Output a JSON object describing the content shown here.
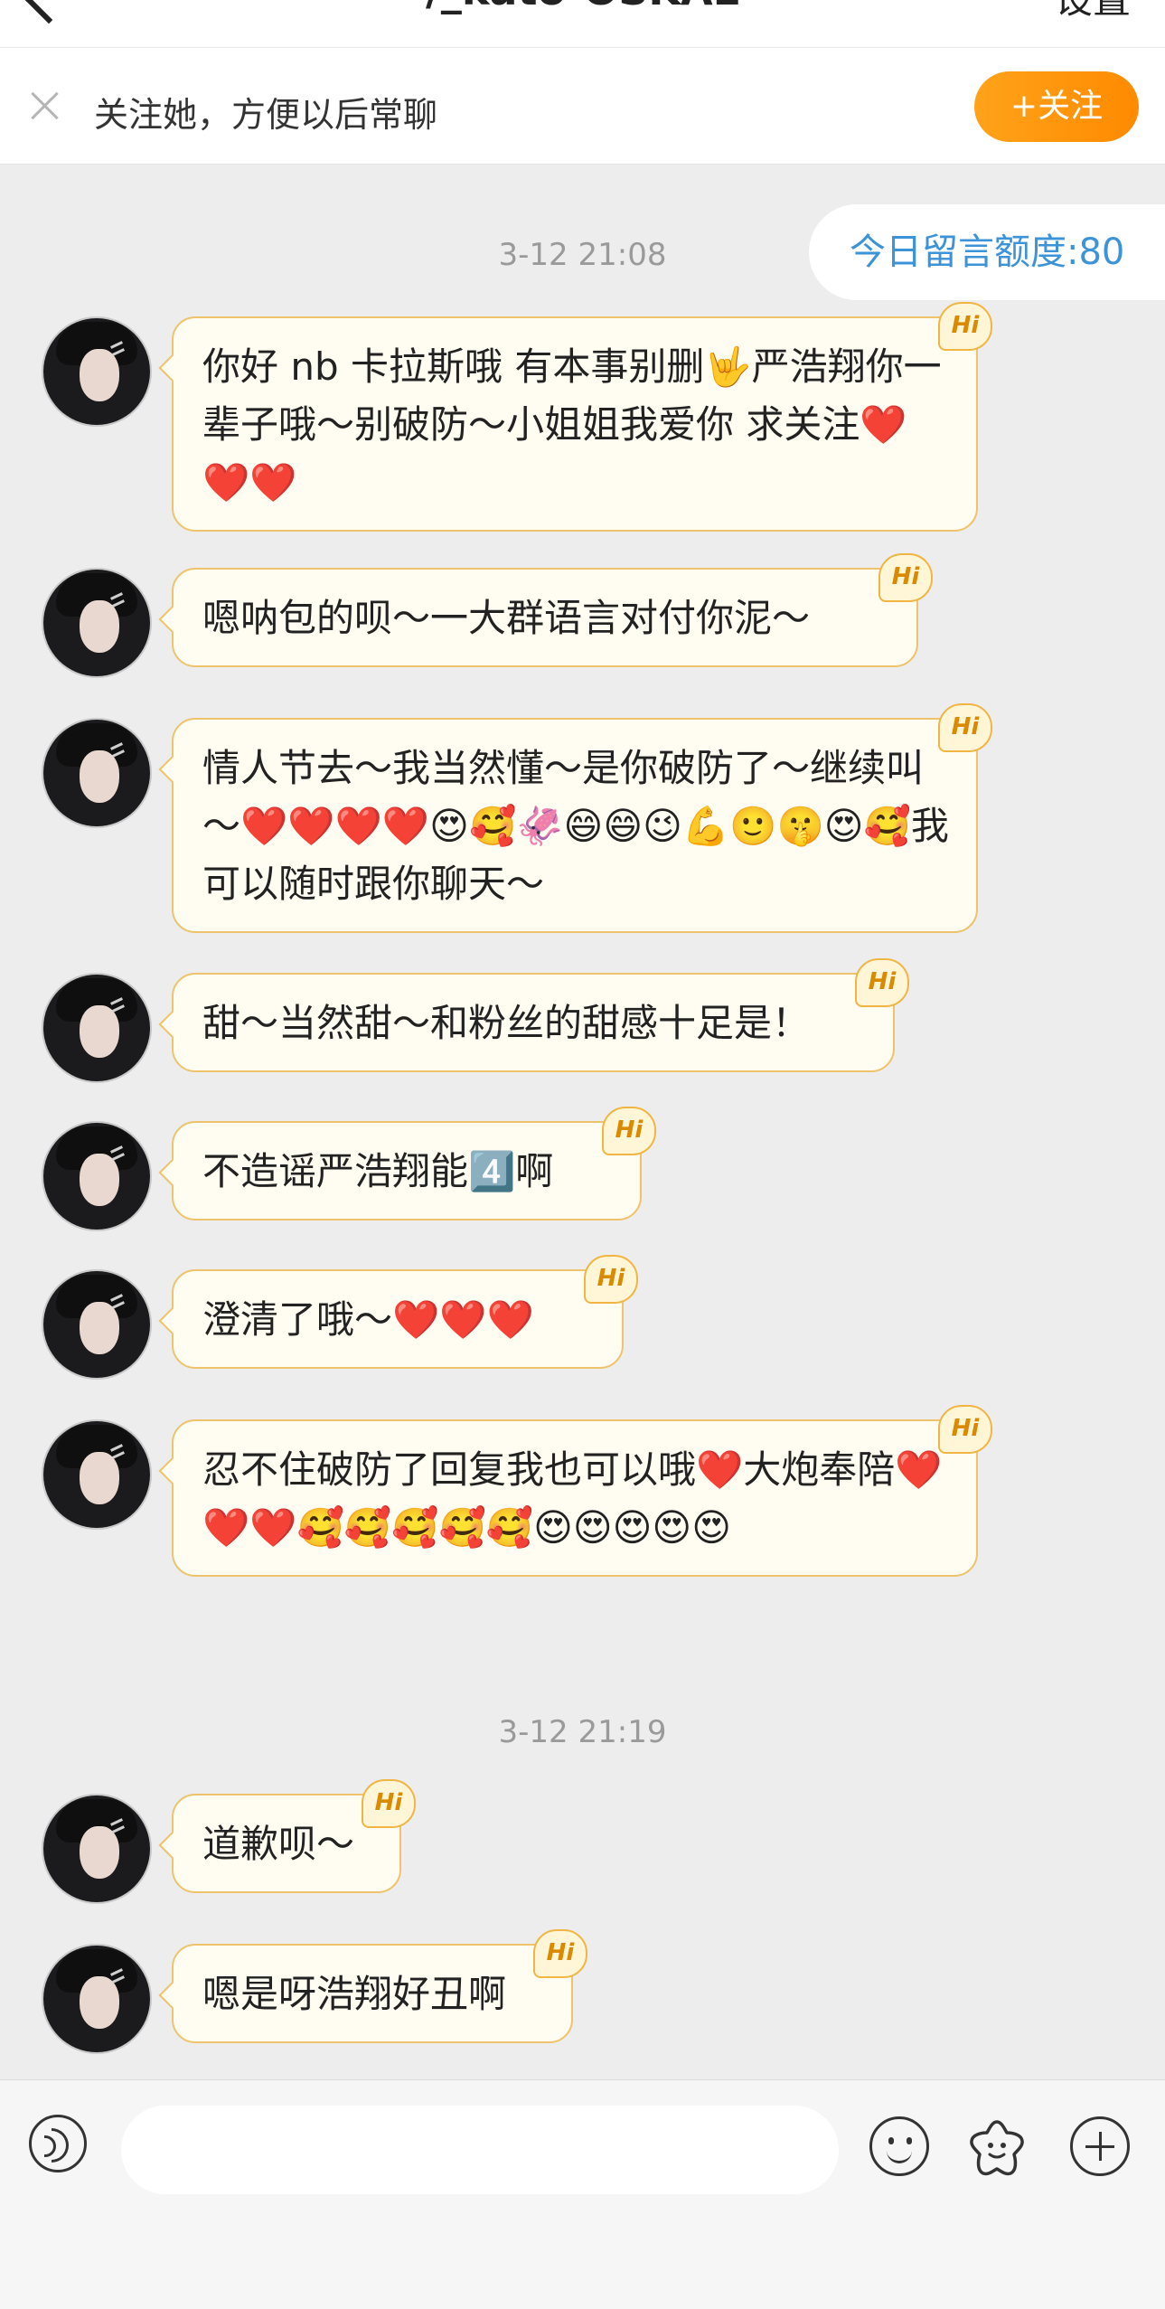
{
  "nav": {
    "title": "/_katö-OSKAL",
    "settings_label": "设置"
  },
  "follow_bar": {
    "prompt": "关注她，方便以后常聊",
    "follow_label": "+关注"
  },
  "quota": {
    "label": "今日留言额度:80"
  },
  "timestamps": [
    "3-12 21:08",
    "3-12 21:19"
  ],
  "messages": [
    {
      "text": "你好 nb 卡拉斯哦 有本事别删🤟严浩翔你一辈子哦～别破防～小姐姐我爱你 求关注❤️❤️❤️",
      "badge": "Hi"
    },
    {
      "text": "嗯呐包的呗～一大群语言对付你泥～",
      "badge": "Hi"
    },
    {
      "text": "情人节去～我当然懂～是你破防了～继续叫～❤️❤️❤️❤️😍🥰🦑😄😄😉💪🙂🤫😍🥰我可以随时跟你聊天～",
      "badge": "Hi"
    },
    {
      "text": "甜～当然甜～和粉丝的甜感十足是！",
      "badge": "Hi"
    },
    {
      "text": "不造谣严浩翔能4️⃣啊",
      "badge": "Hi"
    },
    {
      "text": "澄清了哦～❤️❤️❤️",
      "badge": "Hi"
    },
    {
      "text": "忍不住破防了回复我也可以哦❤️大炮奉陪❤️❤️❤️🥰🥰🥰🥰🥰😍😍😍😍😍",
      "badge": "Hi"
    },
    {
      "text": "道歉呗～",
      "badge": "Hi"
    },
    {
      "text": "嗯是呀浩翔好丑啊",
      "badge": "Hi"
    }
  ],
  "composer": {
    "placeholder": ""
  },
  "colors": {
    "accent_orange": "#ff8a00",
    "quota_blue": "#3d93d8",
    "bubble_border": "#efc36b",
    "background": "#ededed"
  },
  "icons": [
    "back-icon",
    "close-icon",
    "voice-icon",
    "emoji-icon",
    "sticker-icon",
    "add-icon"
  ]
}
